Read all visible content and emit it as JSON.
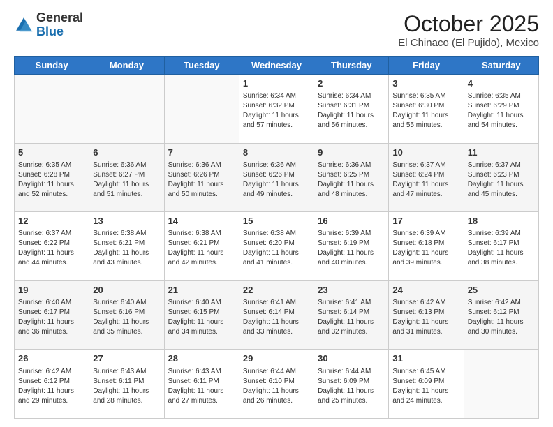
{
  "header": {
    "logo_general": "General",
    "logo_blue": "Blue",
    "month_title": "October 2025",
    "location": "El Chinaco (El Pujido), Mexico"
  },
  "weekdays": [
    "Sunday",
    "Monday",
    "Tuesday",
    "Wednesday",
    "Thursday",
    "Friday",
    "Saturday"
  ],
  "weeks": [
    [
      {
        "day": "",
        "info": ""
      },
      {
        "day": "",
        "info": ""
      },
      {
        "day": "",
        "info": ""
      },
      {
        "day": "1",
        "info": "Sunrise: 6:34 AM\nSunset: 6:32 PM\nDaylight: 11 hours and 57 minutes."
      },
      {
        "day": "2",
        "info": "Sunrise: 6:34 AM\nSunset: 6:31 PM\nDaylight: 11 hours and 56 minutes."
      },
      {
        "day": "3",
        "info": "Sunrise: 6:35 AM\nSunset: 6:30 PM\nDaylight: 11 hours and 55 minutes."
      },
      {
        "day": "4",
        "info": "Sunrise: 6:35 AM\nSunset: 6:29 PM\nDaylight: 11 hours and 54 minutes."
      }
    ],
    [
      {
        "day": "5",
        "info": "Sunrise: 6:35 AM\nSunset: 6:28 PM\nDaylight: 11 hours and 52 minutes."
      },
      {
        "day": "6",
        "info": "Sunrise: 6:36 AM\nSunset: 6:27 PM\nDaylight: 11 hours and 51 minutes."
      },
      {
        "day": "7",
        "info": "Sunrise: 6:36 AM\nSunset: 6:26 PM\nDaylight: 11 hours and 50 minutes."
      },
      {
        "day": "8",
        "info": "Sunrise: 6:36 AM\nSunset: 6:26 PM\nDaylight: 11 hours and 49 minutes."
      },
      {
        "day": "9",
        "info": "Sunrise: 6:36 AM\nSunset: 6:25 PM\nDaylight: 11 hours and 48 minutes."
      },
      {
        "day": "10",
        "info": "Sunrise: 6:37 AM\nSunset: 6:24 PM\nDaylight: 11 hours and 47 minutes."
      },
      {
        "day": "11",
        "info": "Sunrise: 6:37 AM\nSunset: 6:23 PM\nDaylight: 11 hours and 45 minutes."
      }
    ],
    [
      {
        "day": "12",
        "info": "Sunrise: 6:37 AM\nSunset: 6:22 PM\nDaylight: 11 hours and 44 minutes."
      },
      {
        "day": "13",
        "info": "Sunrise: 6:38 AM\nSunset: 6:21 PM\nDaylight: 11 hours and 43 minutes."
      },
      {
        "day": "14",
        "info": "Sunrise: 6:38 AM\nSunset: 6:21 PM\nDaylight: 11 hours and 42 minutes."
      },
      {
        "day": "15",
        "info": "Sunrise: 6:38 AM\nSunset: 6:20 PM\nDaylight: 11 hours and 41 minutes."
      },
      {
        "day": "16",
        "info": "Sunrise: 6:39 AM\nSunset: 6:19 PM\nDaylight: 11 hours and 40 minutes."
      },
      {
        "day": "17",
        "info": "Sunrise: 6:39 AM\nSunset: 6:18 PM\nDaylight: 11 hours and 39 minutes."
      },
      {
        "day": "18",
        "info": "Sunrise: 6:39 AM\nSunset: 6:17 PM\nDaylight: 11 hours and 38 minutes."
      }
    ],
    [
      {
        "day": "19",
        "info": "Sunrise: 6:40 AM\nSunset: 6:17 PM\nDaylight: 11 hours and 36 minutes."
      },
      {
        "day": "20",
        "info": "Sunrise: 6:40 AM\nSunset: 6:16 PM\nDaylight: 11 hours and 35 minutes."
      },
      {
        "day": "21",
        "info": "Sunrise: 6:40 AM\nSunset: 6:15 PM\nDaylight: 11 hours and 34 minutes."
      },
      {
        "day": "22",
        "info": "Sunrise: 6:41 AM\nSunset: 6:14 PM\nDaylight: 11 hours and 33 minutes."
      },
      {
        "day": "23",
        "info": "Sunrise: 6:41 AM\nSunset: 6:14 PM\nDaylight: 11 hours and 32 minutes."
      },
      {
        "day": "24",
        "info": "Sunrise: 6:42 AM\nSunset: 6:13 PM\nDaylight: 11 hours and 31 minutes."
      },
      {
        "day": "25",
        "info": "Sunrise: 6:42 AM\nSunset: 6:12 PM\nDaylight: 11 hours and 30 minutes."
      }
    ],
    [
      {
        "day": "26",
        "info": "Sunrise: 6:42 AM\nSunset: 6:12 PM\nDaylight: 11 hours and 29 minutes."
      },
      {
        "day": "27",
        "info": "Sunrise: 6:43 AM\nSunset: 6:11 PM\nDaylight: 11 hours and 28 minutes."
      },
      {
        "day": "28",
        "info": "Sunrise: 6:43 AM\nSunset: 6:11 PM\nDaylight: 11 hours and 27 minutes."
      },
      {
        "day": "29",
        "info": "Sunrise: 6:44 AM\nSunset: 6:10 PM\nDaylight: 11 hours and 26 minutes."
      },
      {
        "day": "30",
        "info": "Sunrise: 6:44 AM\nSunset: 6:09 PM\nDaylight: 11 hours and 25 minutes."
      },
      {
        "day": "31",
        "info": "Sunrise: 6:45 AM\nSunset: 6:09 PM\nDaylight: 11 hours and 24 minutes."
      },
      {
        "day": "",
        "info": ""
      }
    ]
  ]
}
